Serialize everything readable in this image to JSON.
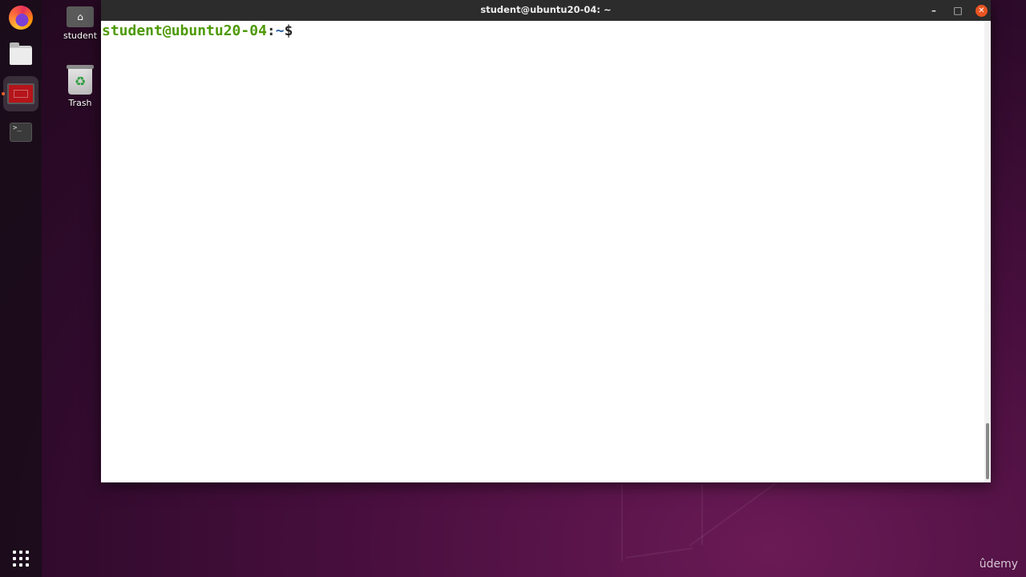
{
  "window": {
    "title": "student@ubuntu20-04: ~",
    "minimize_glyph": "–",
    "maximize_glyph": "□",
    "close_glyph": "✕"
  },
  "terminal": {
    "prompt_user_host": "student@ubuntu20-04",
    "prompt_separator": ":",
    "prompt_path": "~",
    "prompt_symbol": "$"
  },
  "desktop": {
    "home_label": "student",
    "trash_label": "Trash"
  },
  "dock": {
    "items": [
      {
        "icon": "firefox-icon"
      },
      {
        "icon": "files-icon"
      },
      {
        "icon": "screen-recorder-icon",
        "active": true
      },
      {
        "icon": "terminal-icon"
      }
    ],
    "show_apps_icon": "app-grid-icon"
  },
  "terminal_icon_glyph": ">_",
  "watermark": "ûdemy",
  "colors": {
    "prompt_user": "#4e9a06",
    "prompt_path": "#3465a4",
    "close_button": "#e95420",
    "titlebar": "#2c2c2c"
  }
}
